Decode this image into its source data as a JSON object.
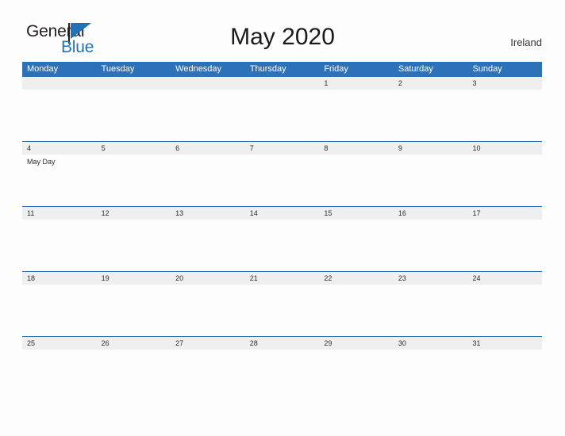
{
  "brand": {
    "name_part1": "General",
    "name_part2": "Blue",
    "flag_icon": "blue-flag-triangle-icon",
    "color_primary": "#2272b8",
    "color_text": "#231f20"
  },
  "header": {
    "title": "May 2020",
    "country": "Ireland"
  },
  "calendar": {
    "header_color": "#2d72b8",
    "date_band_color": "#efefef",
    "weekdays": [
      "Monday",
      "Tuesday",
      "Wednesday",
      "Thursday",
      "Friday",
      "Saturday",
      "Sunday"
    ],
    "weeks": [
      {
        "days": [
          {
            "date": "",
            "events": []
          },
          {
            "date": "",
            "events": []
          },
          {
            "date": "",
            "events": []
          },
          {
            "date": "",
            "events": []
          },
          {
            "date": "1",
            "events": []
          },
          {
            "date": "2",
            "events": []
          },
          {
            "date": "3",
            "events": []
          }
        ]
      },
      {
        "days": [
          {
            "date": "4",
            "events": [
              "May Day"
            ]
          },
          {
            "date": "5",
            "events": []
          },
          {
            "date": "6",
            "events": []
          },
          {
            "date": "7",
            "events": []
          },
          {
            "date": "8",
            "events": []
          },
          {
            "date": "9",
            "events": []
          },
          {
            "date": "10",
            "events": []
          }
        ]
      },
      {
        "days": [
          {
            "date": "11",
            "events": []
          },
          {
            "date": "12",
            "events": []
          },
          {
            "date": "13",
            "events": []
          },
          {
            "date": "14",
            "events": []
          },
          {
            "date": "15",
            "events": []
          },
          {
            "date": "16",
            "events": []
          },
          {
            "date": "17",
            "events": []
          }
        ]
      },
      {
        "days": [
          {
            "date": "18",
            "events": []
          },
          {
            "date": "19",
            "events": []
          },
          {
            "date": "20",
            "events": []
          },
          {
            "date": "21",
            "events": []
          },
          {
            "date": "22",
            "events": []
          },
          {
            "date": "23",
            "events": []
          },
          {
            "date": "24",
            "events": []
          }
        ]
      },
      {
        "days": [
          {
            "date": "25",
            "events": []
          },
          {
            "date": "26",
            "events": []
          },
          {
            "date": "27",
            "events": []
          },
          {
            "date": "28",
            "events": []
          },
          {
            "date": "29",
            "events": []
          },
          {
            "date": "30",
            "events": []
          },
          {
            "date": "31",
            "events": []
          }
        ]
      }
    ]
  }
}
